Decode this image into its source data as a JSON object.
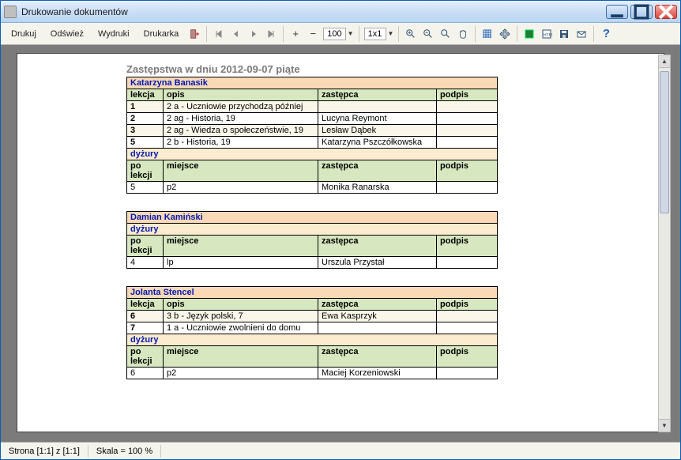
{
  "window": {
    "title": "Drukowanie dokumentów"
  },
  "toolbar": {
    "print": "Drukuj",
    "refresh": "Odśwież",
    "prints": "Wydruki",
    "printer": "Drukarka",
    "zoom_value": "100",
    "grid_value": "1x1"
  },
  "document": {
    "title": "Zastępstwa w dniu 2012-09-07 piąte",
    "headers": {
      "lekcja": "lekcja",
      "opis": "opis",
      "zastepca": "zastępca",
      "podpis": "podpis",
      "dyzury": "dyżury",
      "po_lekcji": "po lekcji",
      "miejsce": "miejsce"
    },
    "teachers": [
      {
        "name": "Katarzyna Banasik",
        "lessons": [
          {
            "lekcja": "1",
            "opis": "2 a - Uczniowie przychodzą później",
            "zastepca": "",
            "podpis": ""
          },
          {
            "lekcja": "2",
            "opis": "2 ag - Historia, 19",
            "zastepca": "Lucyna Reymont",
            "podpis": ""
          },
          {
            "lekcja": "3",
            "opis": "2 ag - Wiedza o społeczeństwie, 19",
            "zastepca": "Lesław Dąbek",
            "podpis": ""
          },
          {
            "lekcja": "5",
            "opis": "2 b - Historia, 19",
            "zastepca": "Katarzyna Pszczółkowska",
            "podpis": ""
          }
        ],
        "dyzury": [
          {
            "po_lekcji": "5",
            "miejsce": "p2",
            "zastepca": "Monika Ranarska",
            "podpis": ""
          }
        ]
      },
      {
        "name": "Damian Kamiński",
        "lessons": [],
        "dyzury": [
          {
            "po_lekcji": "4",
            "miejsce": "lp",
            "zastepca": "Urszula Przystał",
            "podpis": ""
          }
        ]
      },
      {
        "name": "Jolanta Stencel",
        "lessons": [
          {
            "lekcja": "6",
            "opis": "3 b - Język polski, 7",
            "zastepca": "Ewa Kasprzyk",
            "podpis": ""
          },
          {
            "lekcja": "7",
            "opis": "1 a - Uczniowie zwolnieni do domu",
            "zastepca": "",
            "podpis": ""
          }
        ],
        "dyzury": [
          {
            "po_lekcji": "6",
            "miejsce": "p2",
            "zastepca": "Maciej Korzeniowski",
            "podpis": ""
          }
        ]
      }
    ]
  },
  "statusbar": {
    "page": "Strona [1:1] z [1:1]",
    "scale": "Skala = 100 %"
  }
}
